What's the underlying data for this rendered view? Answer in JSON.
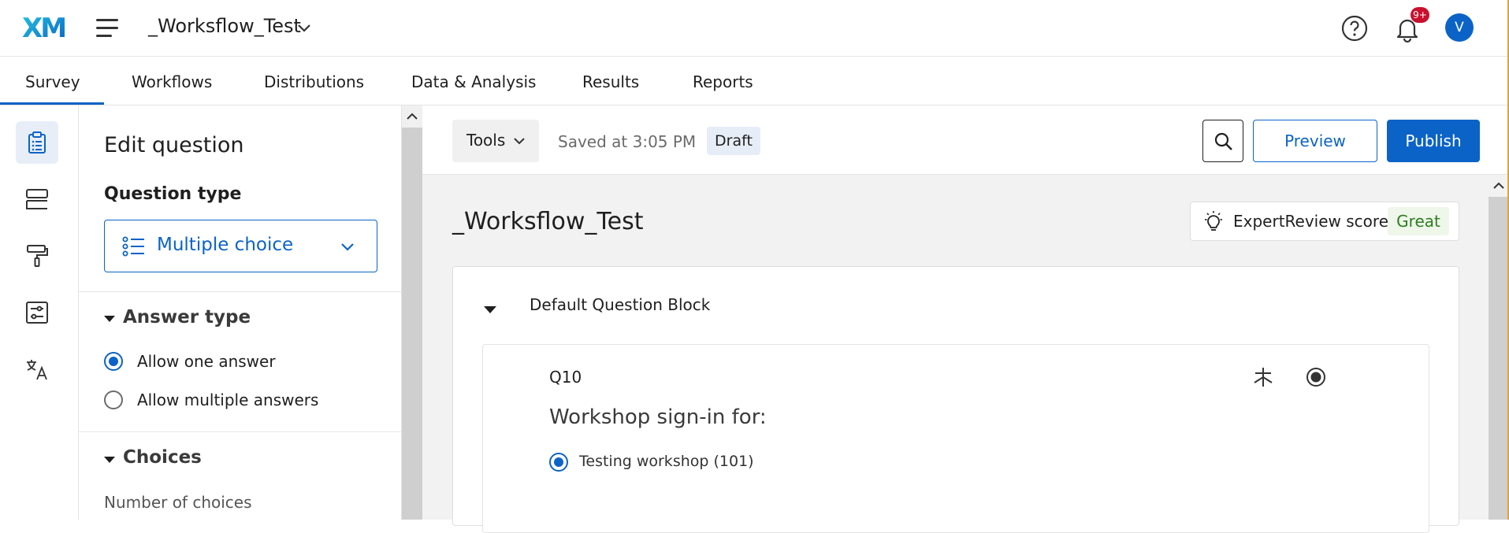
{
  "header": {
    "logo": "XM",
    "project_title": "_Worksflow_Test",
    "notification_badge": "9+",
    "avatar_initial": "V"
  },
  "tabs": [
    {
      "label": "Survey",
      "active": true
    },
    {
      "label": "Workflows"
    },
    {
      "label": "Distributions"
    },
    {
      "label": "Data & Analysis"
    },
    {
      "label": "Results"
    },
    {
      "label": "Reports"
    }
  ],
  "rail": {
    "icons": [
      "survey-clipboard-icon",
      "blocks-icon",
      "paint-roller-icon",
      "survey-options-icon",
      "translate-icon"
    ]
  },
  "edit_panel": {
    "title": "Edit question",
    "question_type_label": "Question type",
    "question_type_value": "Multiple choice",
    "answer_type": {
      "heading": "Answer type",
      "options": [
        {
          "label": "Allow one answer",
          "selected": true
        },
        {
          "label": "Allow multiple answers",
          "selected": false
        }
      ]
    },
    "choices": {
      "heading": "Choices",
      "number_label": "Number of choices"
    }
  },
  "toolbar": {
    "tools_label": "Tools",
    "saved_text": "Saved at 3:05 PM",
    "status_badge": "Draft",
    "preview_label": "Preview",
    "publish_label": "Publish"
  },
  "survey": {
    "title": "_Worksflow_Test",
    "expert_review_label": "ExpertReview score",
    "expert_review_score": "Great",
    "block_title": "Default Question Block",
    "question": {
      "number": "Q10",
      "text": "Workshop sign-in for:",
      "choices": [
        {
          "label": "Testing workshop (101)",
          "selected": true
        }
      ]
    }
  },
  "colors": {
    "accent": "#0b63c7",
    "badge_red": "#c8102e",
    "great_green": "#2e7d1f"
  }
}
